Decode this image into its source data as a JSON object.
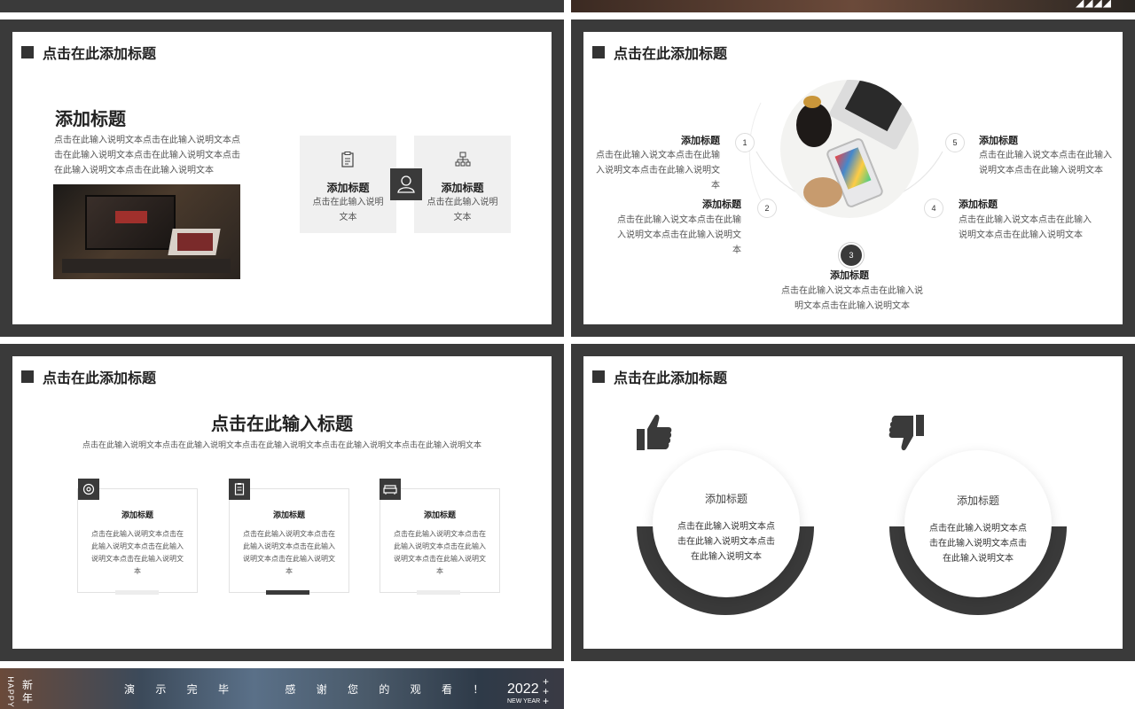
{
  "colors": {
    "frame": "#3a3a3a",
    "slide_bg": "#ffffff",
    "card_bg": "#f0f0f0",
    "accent_dark": "#333333"
  },
  "top_strip": {
    "right_marks": "◢◢◢◢"
  },
  "slide1": {
    "header": "点击在此添加标题",
    "title": "添加标题",
    "desc": "点击在此输入说明文本点击在此输入说明文本点击在此输入说明文本点击在此输入说明文本点击在此输入说明文本点击在此输入说明文本",
    "photo_icon": "laptop-photo",
    "cards": [
      {
        "icon": "clipboard-icon",
        "title": "添加标题",
        "text": "点击在此输入说明文本"
      },
      {
        "icon": "org-chart-icon",
        "title": "添加标题",
        "text": "点击在此输入说明文本"
      }
    ],
    "center_icon": "user-icon"
  },
  "slide2": {
    "header": "点击在此添加标题",
    "items": [
      {
        "num": "1",
        "title": "添加标题",
        "text": "点击在此输入说文本点击在此输入说明文本点击在此输入说明文本"
      },
      {
        "num": "2",
        "title": "添加标题",
        "text": "点击在此输入说文本点击在此输入说明文本点击在此输入说明文本"
      },
      {
        "num": "3",
        "title": "添加标题",
        "text": "点击在此输入说文本点击在此输入说明文本点击在此输入说明文本"
      },
      {
        "num": "4",
        "title": "添加标题",
        "text": "点击在此输入说文本点击在此输入说明文本点击在此输入说明文本"
      },
      {
        "num": "5",
        "title": "添加标题",
        "text": "点击在此输入说文本点击在此输入说明文本点击在此输入说明文本"
      }
    ]
  },
  "slide3": {
    "header": "点击在此添加标题",
    "title": "点击在此输入标题",
    "subtitle": "点击在此输入说明文本点击在此输入说明文本点击在此输入说明文本点击在此输入说明文本点击在此输入说明文本",
    "boxes": [
      {
        "icon": "target-icon",
        "title": "添加标题",
        "text": "点击在此输入说明文本点击在此输入说明文本点击在此输入说明文本点击在此输入说明文本"
      },
      {
        "icon": "clipboard-icon",
        "title": "添加标题",
        "text": "点击在此输入说明文本点击在此输入说明文本点击在此输入说明文本点击在此输入说明文本"
      },
      {
        "icon": "sofa-icon",
        "title": "添加标题",
        "text": "点击在此输入说明文本点击在此输入说明文本点击在此输入说明文本点击在此输入说明文本"
      }
    ]
  },
  "slide4": {
    "header": "点击在此添加标题",
    "left": {
      "icon": "thumbs-up-icon",
      "title": "添加标题",
      "text": "点击在此输入说明文本点击在此输入说明文本点击在此输入说明文本"
    },
    "right": {
      "icon": "thumbs-down-icon",
      "title": "添加标题",
      "text": "点击在此输入说明文本点击在此输入说明文本点击在此输入说明文本"
    }
  },
  "end_slide": {
    "vertical_left": "新年",
    "vertical_small": "HAPPY",
    "message": "演 示 完 毕    感 谢 您 的 观 看 ！",
    "year": "2022",
    "year_sub": "NEW YEAR"
  }
}
